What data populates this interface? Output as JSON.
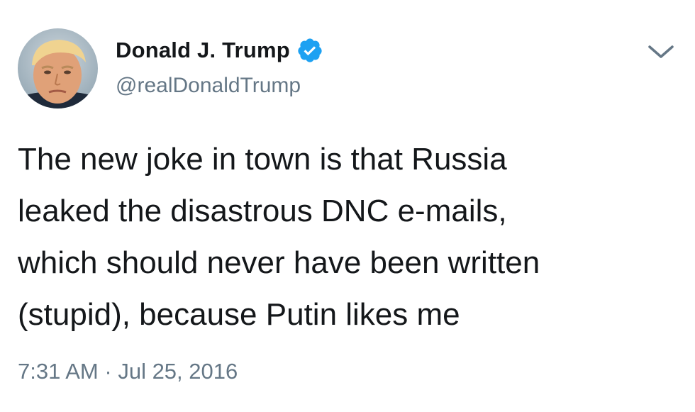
{
  "tweet": {
    "author": {
      "display_name": "Donald J. Trump",
      "handle": "@realDonaldTrump",
      "verified_icon": "verified-badge-icon",
      "avatar_icon": "profile-avatar"
    },
    "text_lines": [
      "The new joke in town is that Russia",
      "leaked the disastrous DNC e-mails,",
      "which should never have been written",
      "(stupid), because Putin likes me"
    ],
    "time": "7:31 AM",
    "separator": "·",
    "date": "Jul 25, 2016",
    "menu_icon": "chevron-down-icon"
  },
  "colors": {
    "text": "#14171a",
    "secondary": "#657786",
    "verified": "#1da1f2",
    "background": "#ffffff"
  }
}
